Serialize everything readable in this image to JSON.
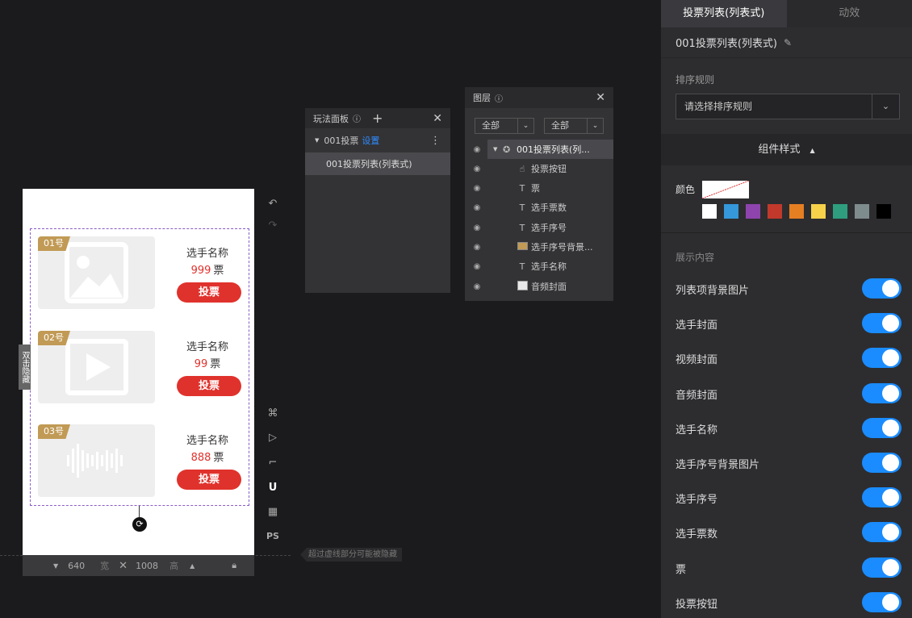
{
  "canvas": {
    "side_tab": "双击隐藏",
    "items": [
      {
        "badge": "01号",
        "name": "选手名称",
        "votes": "999",
        "unit": "票",
        "button": "投票",
        "cover": "image-placeholder-icon"
      },
      {
        "badge": "02号",
        "name": "选手名称",
        "votes": "99",
        "unit": "票",
        "button": "投票",
        "cover": "play-placeholder-icon"
      },
      {
        "badge": "03号",
        "name": "选手名称",
        "votes": "888",
        "unit": "票",
        "button": "投票",
        "cover": "audio-wave-icon"
      }
    ],
    "size_bar": {
      "width": "640",
      "width_label": "宽",
      "height": "1008",
      "height_label": "高"
    },
    "hint": "超过虚线部分可能被隐藏",
    "tools": {
      "ps": "PS"
    }
  },
  "play_panel": {
    "title": "玩法面板",
    "group": "001投票",
    "settings_link": "设置",
    "item": "001投票列表(列表式)"
  },
  "layer_panel": {
    "title": "图层",
    "filter1": "全部",
    "filter2": "全部",
    "layers": [
      {
        "label": "001投票列表(列...",
        "icon": "component-icon"
      },
      {
        "label": "投票按钮",
        "icon": "pointer-icon"
      },
      {
        "label": "票",
        "icon": "text-icon"
      },
      {
        "label": "选手票数",
        "icon": "text-icon"
      },
      {
        "label": "选手序号",
        "icon": "text-icon"
      },
      {
        "label": "选手序号背景...",
        "icon": "image-icon"
      },
      {
        "label": "选手名称",
        "icon": "text-icon"
      },
      {
        "label": "音频封面",
        "icon": "image-icon"
      }
    ]
  },
  "right_panel": {
    "tabs": [
      "投票列表(列表式)",
      "动效"
    ],
    "component_title": "001投票列表(列表式)",
    "sort_label": "排序规则",
    "sort_placeholder": "请选择排序规则",
    "style_header": "组件样式",
    "color_label": "颜色",
    "swatches": [
      "#ffffff",
      "#3498db",
      "#8e44ad",
      "#c0392b",
      "#e67e22",
      "#f7d14a",
      "#2e9e7e",
      "#7f8c8d",
      "#000000"
    ],
    "show_label": "展示内容",
    "toggles": [
      "列表项背景图片",
      "选手封面",
      "视频封面",
      "音频封面",
      "选手名称",
      "选手序号背景图片",
      "选手序号",
      "选手票数",
      "票",
      "投票按钮"
    ],
    "toggle_color": "#1a8cff"
  }
}
